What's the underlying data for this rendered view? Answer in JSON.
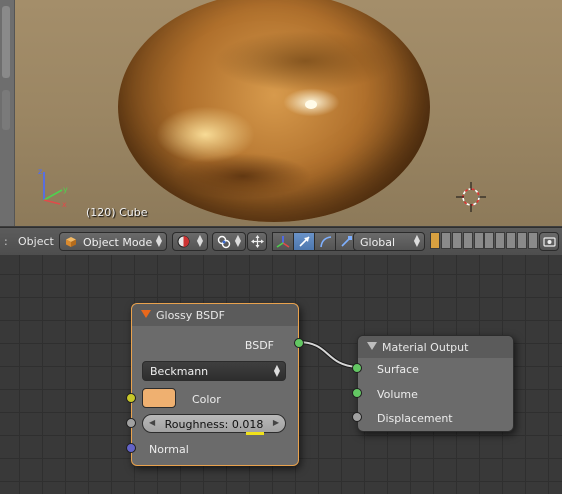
{
  "viewport": {
    "object_label": "(120) Cube",
    "axis_labels": {
      "x": "x",
      "y": "y",
      "z": "z"
    }
  },
  "header": {
    "menu_object": "Object",
    "mode_select": "Object Mode",
    "orientation_select": "Global"
  },
  "nodes": {
    "glossy": {
      "title": "Glossy BSDF",
      "output_label": "BSDF",
      "distribution": "Beckmann",
      "color_label": "Color",
      "roughness_label": "Roughness: 0.018",
      "normal_label": "Normal",
      "swatch_color": "#efb070"
    },
    "output": {
      "title": "Material Output",
      "inputs": [
        "Surface",
        "Volume",
        "Displacement"
      ]
    }
  },
  "colors": {
    "node_selected_border": "#e9a24d",
    "socket_shader": "#63c763",
    "socket_color": "#c7c729",
    "socket_value": "#a1a1a1",
    "socket_vector": "#6363c7",
    "highlight_marker": "#f1e21b"
  }
}
